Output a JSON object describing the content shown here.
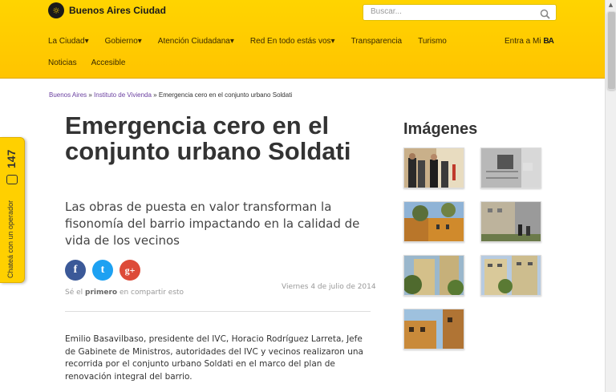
{
  "header": {
    "logo_text": "Buenos Aires Ciudad",
    "search_placeholder": "Buscar...",
    "nav": [
      "La Ciudad",
      "Gobierno",
      "Atención Ciudadana",
      "Red En todo estás vos",
      "Transparencia",
      "Turismo"
    ],
    "nav2": [
      "Noticias",
      "Accesible"
    ],
    "login_label": "Entra a Mi",
    "login_brand": "BA"
  },
  "breadcrumb": {
    "home": "Buenos Aires",
    "sep1": " » ",
    "section": "Instituto de Vivienda",
    "sep2": " » ",
    "current": "Emergencia cero en el conjunto urbano Soldati"
  },
  "article": {
    "title": "Emergencia cero en el conjunto urbano Soldati",
    "subtitle": "Las obras de puesta en valor transforman la fisonomía del barrio impactando en la calidad de vida de los vecinos",
    "share_prefix": "Sé el ",
    "share_bold": "primero",
    "share_suffix": " en compartir esto",
    "date": "Viernes 4 de julio de 2014",
    "body": "Emilio Basavilbaso, presidente del IVC, Horacio Rodríguez Larreta, Jefe de Gabinete de Ministros, autoridades del IVC y vecinos realizaron una recorrida por el conjunto urbano Soldati en el marco del plan de renovación integral del barrio."
  },
  "social": {
    "facebook": "f",
    "twitter": "t",
    "googleplus": "g+"
  },
  "chat": {
    "label": "Chateá con un operador",
    "number": "147"
  },
  "sidebar": {
    "images_title": "Imágenes"
  },
  "colors": {
    "brand_yellow": "#ffd400",
    "link_purple": "#6a3fa0"
  }
}
